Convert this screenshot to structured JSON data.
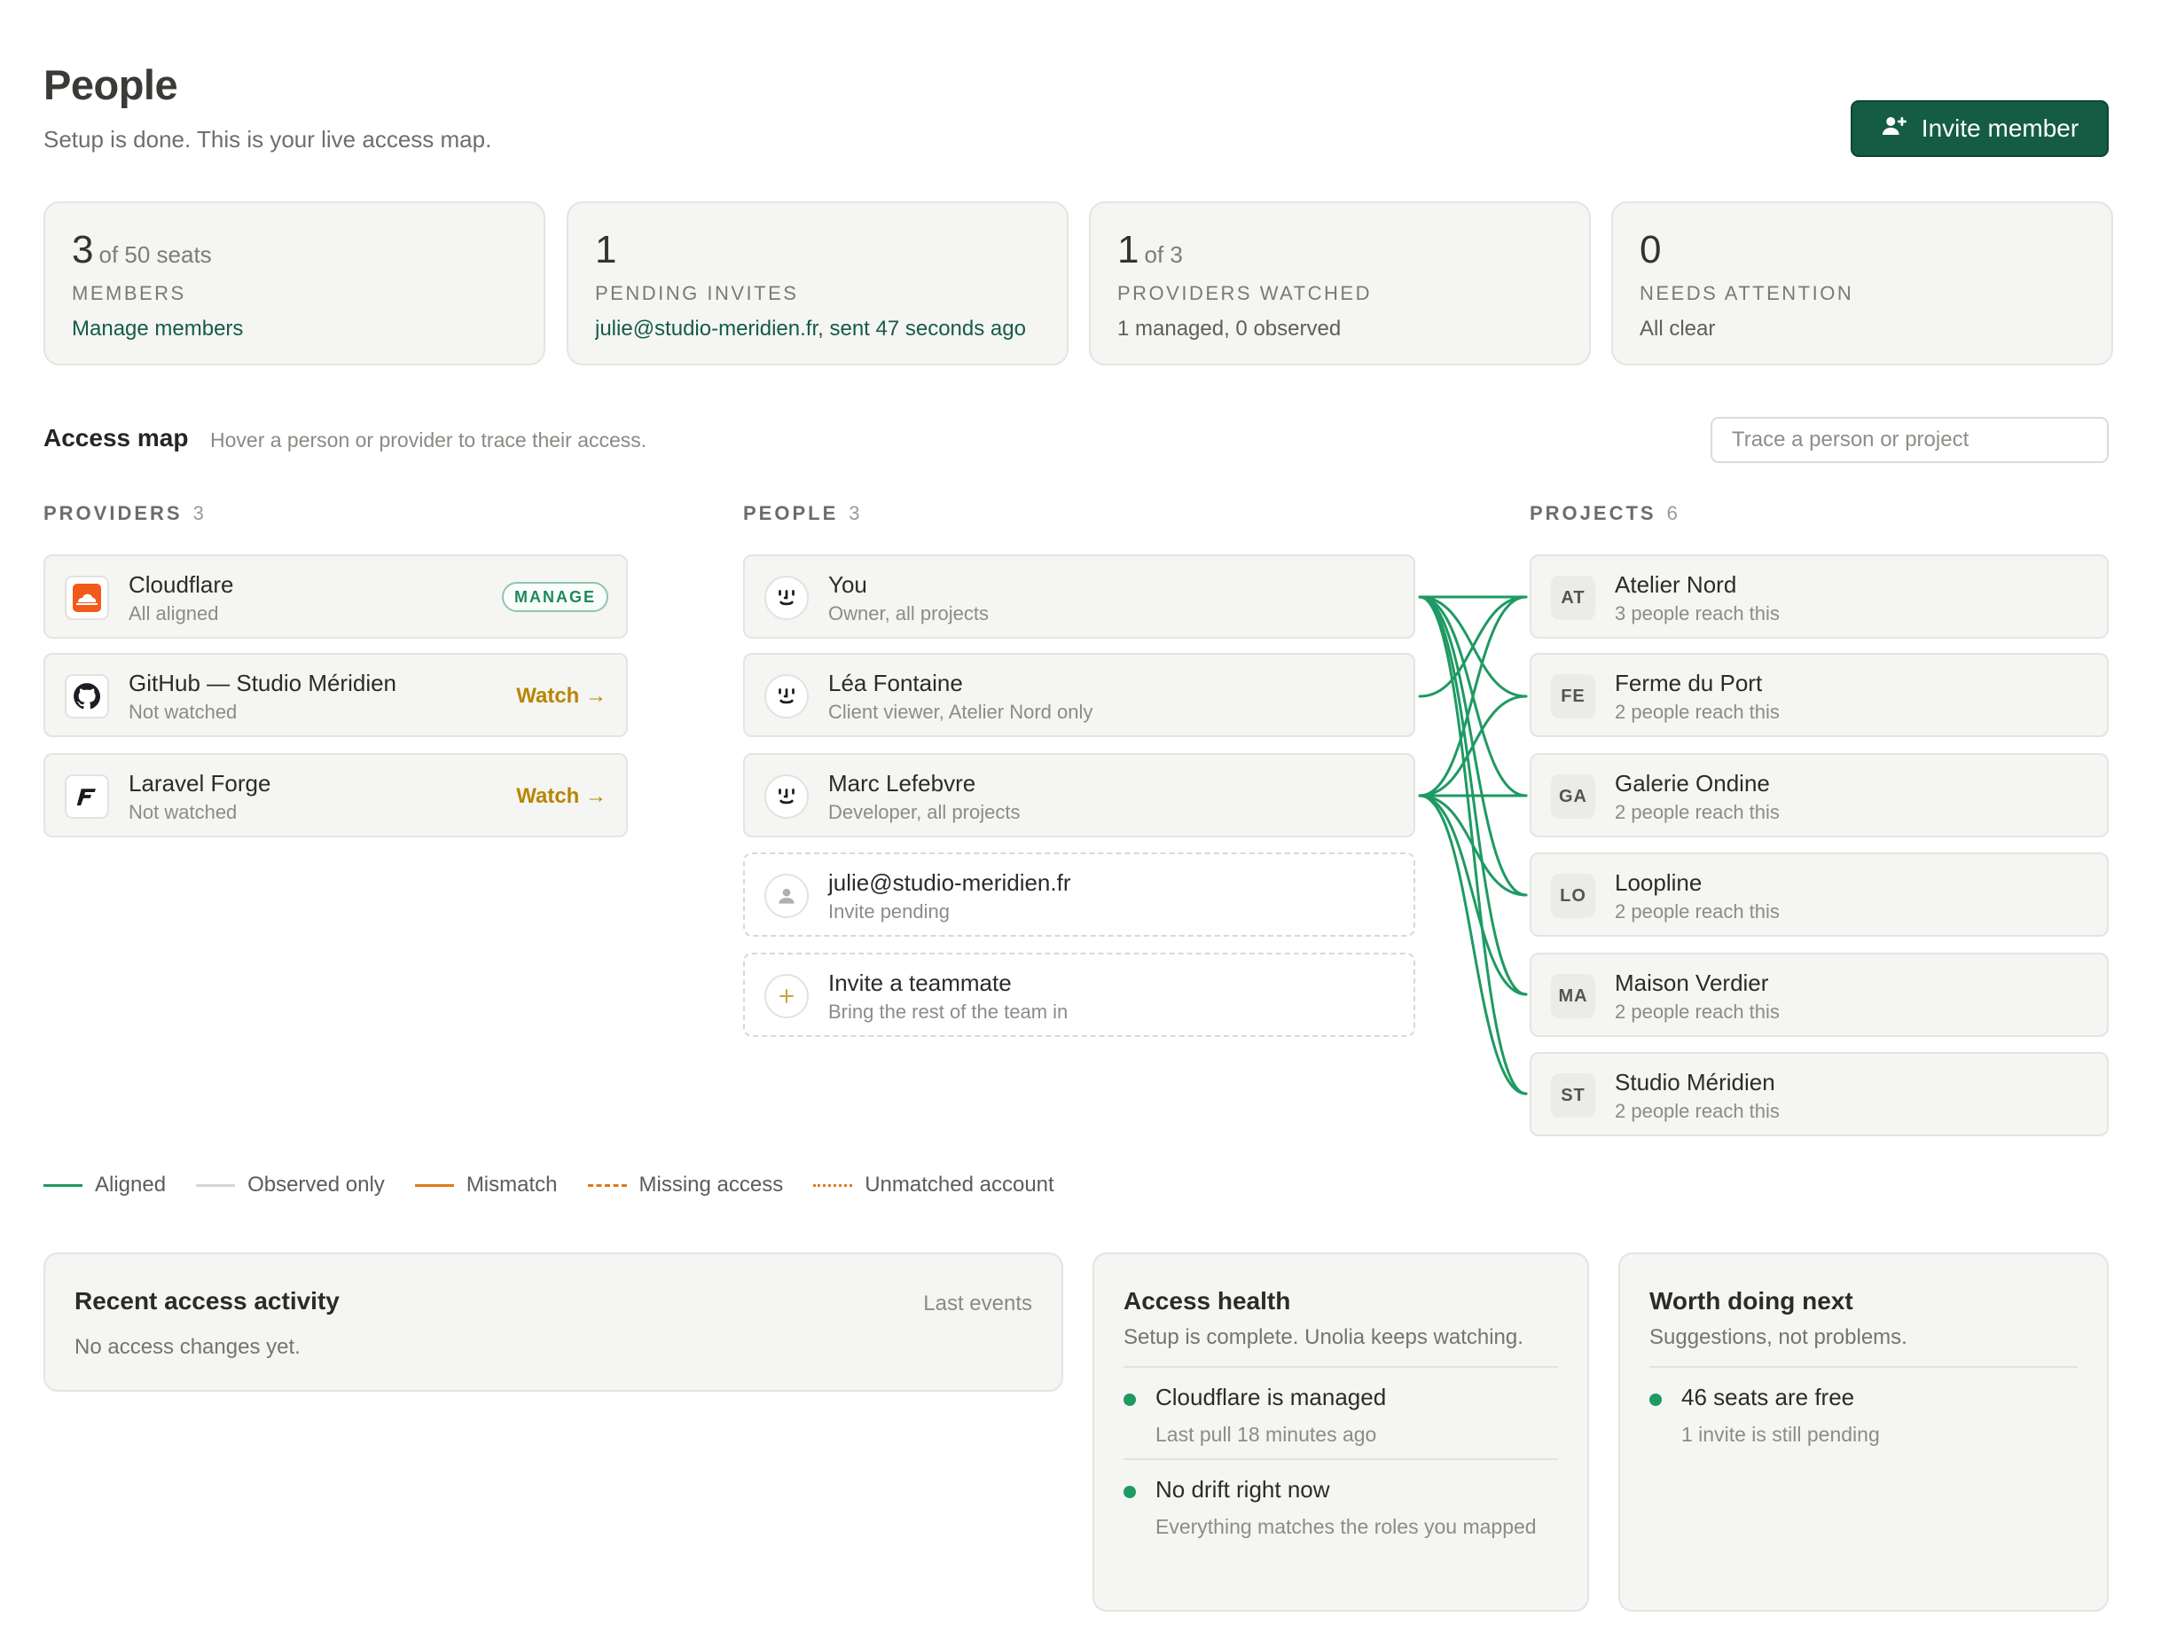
{
  "header": {
    "title": "People",
    "subtitle": "Setup is done. This is your live access map.",
    "invite_label": "Invite member"
  },
  "stats": [
    {
      "value": "3",
      "suffix": "of 50 seats",
      "label": "MEMBERS",
      "detail": "Manage members"
    },
    {
      "value": "1",
      "suffix": "",
      "label": "PENDING INVITES",
      "detail": "julie@studio-meridien.fr, sent 47 seconds ago"
    },
    {
      "value": "1",
      "suffix": "of 3",
      "label": "PROVIDERS WATCHED",
      "detail": "1 managed, 0 observed"
    },
    {
      "value": "0",
      "suffix": "",
      "label": "NEEDS ATTENTION",
      "detail": "All clear"
    }
  ],
  "access_map": {
    "title": "Access map",
    "hint": "Hover a person or provider to trace their access.",
    "trace_placeholder": "Trace a person or project",
    "providers_heading": "PROVIDERS",
    "providers_count": "3",
    "people_heading": "PEOPLE",
    "people_count": "3",
    "projects_heading": "PROJECTS",
    "projects_count": "6",
    "providers": [
      {
        "name": "Cloudflare",
        "status": "All aligned",
        "action": "MANAGE",
        "icon": "cloudflare-icon"
      },
      {
        "name": "GitHub — Studio Méridien",
        "status": "Not watched",
        "action": "Watch →",
        "icon": "github-icon"
      },
      {
        "name": "Laravel Forge",
        "status": "Not watched",
        "action": "Watch →",
        "icon": "forge-icon"
      }
    ],
    "people": [
      {
        "name": "You",
        "role": "Owner, all projects",
        "icon": "face-icon"
      },
      {
        "name": "Léa Fontaine",
        "role": "Client viewer, Atelier Nord only",
        "icon": "face-icon"
      },
      {
        "name": "Marc Lefebvre",
        "role": "Developer, all projects",
        "icon": "face-icon"
      },
      {
        "name": "julie@studio-meridien.fr",
        "role": "Invite pending",
        "icon": "user-icon"
      },
      {
        "name": "Invite a teammate",
        "role": "Bring the rest of the team in",
        "icon": "plus-icon"
      }
    ],
    "projects": [
      {
        "initials": "AT",
        "name": "Atelier Nord",
        "reach": "3 people reach this"
      },
      {
        "initials": "FE",
        "name": "Ferme du Port",
        "reach": "2 people reach this"
      },
      {
        "initials": "GA",
        "name": "Galerie Ondine",
        "reach": "2 people reach this"
      },
      {
        "initials": "LO",
        "name": "Loopline",
        "reach": "2 people reach this"
      },
      {
        "initials": "MA",
        "name": "Maison Verdier",
        "reach": "2 people reach this"
      },
      {
        "initials": "ST",
        "name": "Studio Méridien",
        "reach": "2 people reach this"
      }
    ],
    "colors": {
      "aligned": "#1e9a62",
      "observed": "#d6d6d1",
      "mismatch": "#e07b1a",
      "missing": "#e07b1a",
      "unmatched": "#e07b1a"
    }
  },
  "legend": [
    "Aligned",
    "Observed only",
    "Mismatch",
    "Missing access",
    "Unmatched account"
  ],
  "activity": {
    "title": "Recent access activity",
    "right_label": "Last events",
    "empty": "No access changes yet."
  },
  "health": {
    "title": "Access health",
    "subtitle": "Setup is complete. Unolia keeps watching.",
    "items": [
      {
        "title": "Cloudflare is managed",
        "sub": "Last pull 18 minutes ago"
      },
      {
        "title": "No drift right now",
        "sub": "Everything matches the roles you mapped"
      }
    ]
  },
  "next": {
    "title": "Worth doing next",
    "subtitle": "Suggestions, not problems.",
    "items": [
      {
        "title": "46 seats are free",
        "sub": "1 invite is still pending"
      }
    ]
  }
}
